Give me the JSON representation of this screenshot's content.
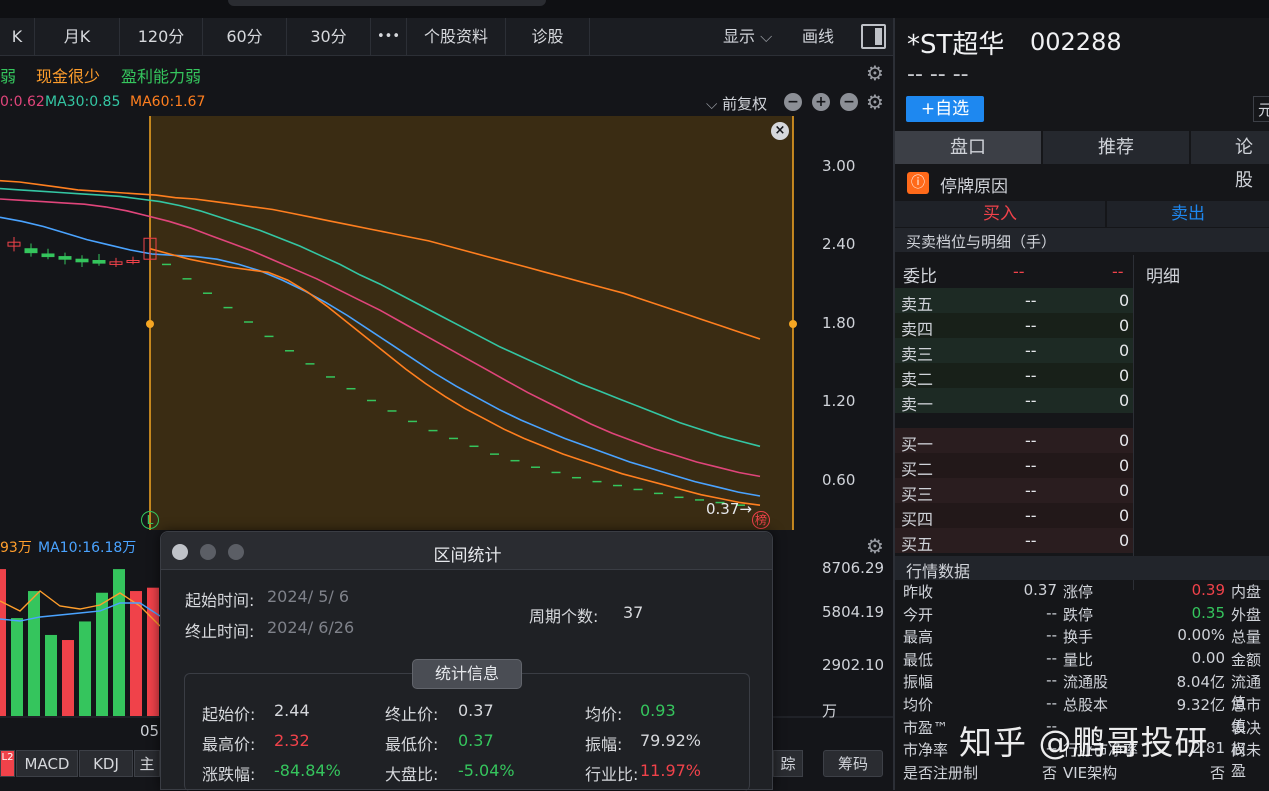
{
  "toolbar": {
    "tabs": [
      "K",
      "月K",
      "120分",
      "60分",
      "30分",
      "•••",
      "个股资料",
      "诊股"
    ],
    "show_label": "显示",
    "draw_label": "画线"
  },
  "tags": [
    "弱",
    "现金很少",
    "盈利能力弱"
  ],
  "ma_legend": {
    "ma20": "0:0.62",
    "ma30": "MA30:0.85",
    "ma60": "MA60:1.67",
    "fuquan": "前复权"
  },
  "colors": {
    "ma20": "#e0457b",
    "ma30": "#34c6a3",
    "ma60": "#ff7f1f",
    "ma10": "#4aa3ff",
    "up": "#f0424a",
    "down": "#35c55d",
    "selection": "#3a2c13"
  },
  "price_axis": [
    "3.00",
    "2.40",
    "1.80",
    "1.20",
    "0.60"
  ],
  "last_price_label": "0.37→",
  "bang_label": "榜",
  "l_marker": "L",
  "volume": {
    "legend_left": "93万",
    "ma10_label": "MA10:16.18万",
    "axis": [
      "8706.29",
      "5804.19",
      "2902.10",
      "万"
    ],
    "date_label": "05"
  },
  "bottom_tabs": [
    "L2",
    "MACD",
    "KDJ",
    "主"
  ],
  "bottom_right_buttons": [
    "踪",
    "筹码"
  ],
  "stock": {
    "name": "*ST超华",
    "code": "002288",
    "price_placeholder": "-- -- --",
    "add_watch": "+自选",
    "right_cut": "元"
  },
  "panel_tabs": [
    "盘口",
    "推荐",
    "论股"
  ],
  "suspend_reason": "停牌原因",
  "buy_label": "买入",
  "sell_label": "卖出",
  "orderbook": {
    "title": "买卖档位与明细（手）",
    "weibi": "委比",
    "weibi_v1": "--",
    "weibi_v2": "--",
    "detail": "明细",
    "sells": [
      [
        "卖五",
        "--",
        "0"
      ],
      [
        "卖四",
        "--",
        "0"
      ],
      [
        "卖三",
        "--",
        "0"
      ],
      [
        "卖二",
        "--",
        "0"
      ],
      [
        "卖一",
        "--",
        "0"
      ]
    ],
    "buys": [
      [
        "买一",
        "--",
        "0"
      ],
      [
        "买二",
        "--",
        "0"
      ],
      [
        "买三",
        "--",
        "0"
      ],
      [
        "买四",
        "--",
        "0"
      ],
      [
        "买五",
        "--",
        "0"
      ]
    ]
  },
  "market_data": {
    "title": "行情数据",
    "rows": [
      [
        "昨收",
        "0.37",
        "涨停",
        "0.39",
        "内盘"
      ],
      [
        "今开",
        "--",
        "跌停",
        "0.35",
        "外盘"
      ],
      [
        "最高",
        "--",
        "换手",
        "0.00%",
        "总量"
      ],
      [
        "最低",
        "--",
        "量比",
        "0.00",
        "金额"
      ],
      [
        "振幅",
        "--",
        "流通股",
        "8.04亿",
        "流通值"
      ],
      [
        "均价",
        "--",
        "总股本",
        "9.32亿",
        "总市值"
      ],
      [
        "市盈™",
        "--",
        "",
        "",
        "表决权"
      ],
      [
        "市净率",
        "--",
        "行业市净率",
        "2.81",
        "尚未盈"
      ],
      [
        "是否注册制",
        "否",
        "VIE架构",
        "否",
        ""
      ]
    ]
  },
  "watermark": "知乎 @鹏哥投研",
  "dialog": {
    "title": "区间统计",
    "start_label": "起始时间:",
    "start_value": "2024/  5/  6",
    "end_label": "终止时间:",
    "end_value": "2024/  6/26",
    "period_label": "周期个数:",
    "period_value": "37",
    "stats_button": "统计信息",
    "stats": [
      {
        "label": "起始价:",
        "value": "2.44",
        "color": "neutral"
      },
      {
        "label": "终止价:",
        "value": "0.37",
        "color": "neutral"
      },
      {
        "label": "均价:",
        "value": "0.93",
        "color": "green"
      },
      {
        "label": "最高价:",
        "value": "2.32",
        "color": "red"
      },
      {
        "label": "最低价:",
        "value": "0.37",
        "color": "green"
      },
      {
        "label": "振幅:",
        "value": "79.92%",
        "color": "neutral"
      },
      {
        "label": "涨跌幅:",
        "value": "-84.84%",
        "color": "green"
      },
      {
        "label": "大盘比:",
        "value": "-5.04%",
        "color": "green"
      },
      {
        "label": "行业比:",
        "value": "11.97%",
        "color": "red"
      }
    ]
  },
  "chart_data": {
    "type": "line",
    "y_range": [
      0.2,
      3.3
    ],
    "x": [
      0,
      1,
      2,
      3,
      4,
      5,
      6,
      7,
      8,
      9,
      10,
      11,
      12,
      13,
      14,
      15,
      16,
      17,
      18,
      19,
      20,
      21,
      22,
      23,
      24,
      25,
      26,
      27,
      28,
      29,
      30,
      31,
      32,
      33,
      34,
      35,
      36,
      37,
      38,
      39,
      40,
      41,
      42,
      43,
      44,
      45,
      46,
      47,
      48,
      49,
      50
    ],
    "series": [
      {
        "name": "MA60",
        "values": [
          2.88,
          2.87,
          2.85,
          2.83,
          2.81,
          2.8,
          2.79,
          2.78,
          2.77,
          2.75,
          2.74,
          2.72,
          2.7,
          2.68,
          2.66,
          2.63,
          2.6,
          2.57,
          2.54,
          2.51,
          2.48,
          2.45,
          2.42,
          2.38,
          2.34,
          2.3,
          2.26,
          2.22,
          2.18,
          2.14,
          2.1,
          2.06,
          2.02,
          1.97,
          1.92,
          1.87,
          1.82,
          1.77,
          1.72,
          1.67
        ]
      },
      {
        "name": "MA30",
        "values": [
          2.82,
          2.81,
          2.8,
          2.79,
          2.78,
          2.77,
          2.76,
          2.74,
          2.72,
          2.69,
          2.65,
          2.6,
          2.55,
          2.5,
          2.44,
          2.38,
          2.31,
          2.24,
          2.16,
          2.09,
          2.01,
          1.93,
          1.85,
          1.77,
          1.69,
          1.61,
          1.54,
          1.47,
          1.4,
          1.33,
          1.27,
          1.21,
          1.15,
          1.09,
          1.03,
          0.98,
          0.93,
          0.89,
          0.85
        ]
      },
      {
        "name": "MA20",
        "values": [
          2.74,
          2.73,
          2.72,
          2.71,
          2.7,
          2.68,
          2.65,
          2.61,
          2.57,
          2.52,
          2.46,
          2.4,
          2.34,
          2.27,
          2.2,
          2.13,
          2.05,
          1.97,
          1.89,
          1.8,
          1.71,
          1.62,
          1.53,
          1.44,
          1.35,
          1.26,
          1.18,
          1.1,
          1.02,
          0.95,
          0.89,
          0.83,
          0.78,
          0.73,
          0.69,
          0.65,
          0.62
        ]
      },
      {
        "name": "MA10",
        "values": [
          2.6,
          2.57,
          2.53,
          2.48,
          2.43,
          2.39,
          2.35,
          2.32,
          2.31,
          2.3,
          2.28,
          2.24,
          2.19,
          2.12,
          2.04,
          1.95,
          1.85,
          1.74,
          1.63,
          1.52,
          1.41,
          1.31,
          1.22,
          1.13,
          1.05,
          0.98,
          0.91,
          0.85,
          0.79,
          0.73,
          0.68,
          0.63,
          0.58,
          0.54,
          0.5,
          0.47
        ]
      },
      {
        "name": "MA5",
        "values": [
          2.36,
          2.32,
          2.28,
          2.25,
          2.22,
          2.2,
          2.18,
          2.12,
          2.03,
          1.92,
          1.8,
          1.68,
          1.56,
          1.44,
          1.33,
          1.23,
          1.14,
          1.06,
          0.98,
          0.91,
          0.85,
          0.79,
          0.74,
          0.69,
          0.64,
          0.6,
          0.56,
          0.52,
          0.48,
          0.45,
          0.42,
          0.4
        ]
      }
    ],
    "candles": [
      {
        "o": 2.38,
        "c": 2.41,
        "h": 2.45,
        "l": 2.34
      },
      {
        "o": 2.36,
        "c": 2.33,
        "h": 2.4,
        "l": 2.3
      },
      {
        "o": 2.32,
        "c": 2.3,
        "h": 2.36,
        "l": 2.28
      },
      {
        "o": 2.3,
        "c": 2.28,
        "h": 2.33,
        "l": 2.24
      },
      {
        "o": 2.28,
        "c": 2.26,
        "h": 2.31,
        "l": 2.22
      },
      {
        "o": 2.27,
        "c": 2.25,
        "h": 2.32,
        "l": 2.23
      },
      {
        "o": 2.24,
        "c": 2.26,
        "h": 2.29,
        "l": 2.22
      },
      {
        "o": 2.26,
        "c": 2.27,
        "h": 2.3,
        "l": 2.24
      },
      {
        "o": 2.28,
        "c": 2.44,
        "h": 2.45,
        "l": 2.27
      }
    ],
    "dashes": [
      2.24,
      2.13,
      2.02,
      1.91,
      1.8,
      1.69,
      1.58,
      1.48,
      1.38,
      1.29,
      1.2,
      1.12,
      1.04,
      0.97,
      0.91,
      0.85,
      0.79,
      0.74,
      0.69,
      0.65,
      0.61,
      0.58,
      0.55,
      0.52,
      0.49,
      0.46,
      0.44,
      0.42,
      0.4
    ],
    "volume_bars": [
      {
        "v": 8700,
        "c": "up"
      },
      {
        "v": 5800,
        "c": "down"
      },
      {
        "v": 7400,
        "c": "down"
      },
      {
        "v": 4800,
        "c": "down"
      },
      {
        "v": 4500,
        "c": "up"
      },
      {
        "v": 5600,
        "c": "down"
      },
      {
        "v": 7300,
        "c": "down"
      },
      {
        "v": 8700,
        "c": "down"
      },
      {
        "v": 7400,
        "c": "up"
      },
      {
        "v": 7600,
        "c": "up"
      },
      {
        "v": 5700,
        "c": "up"
      }
    ]
  }
}
